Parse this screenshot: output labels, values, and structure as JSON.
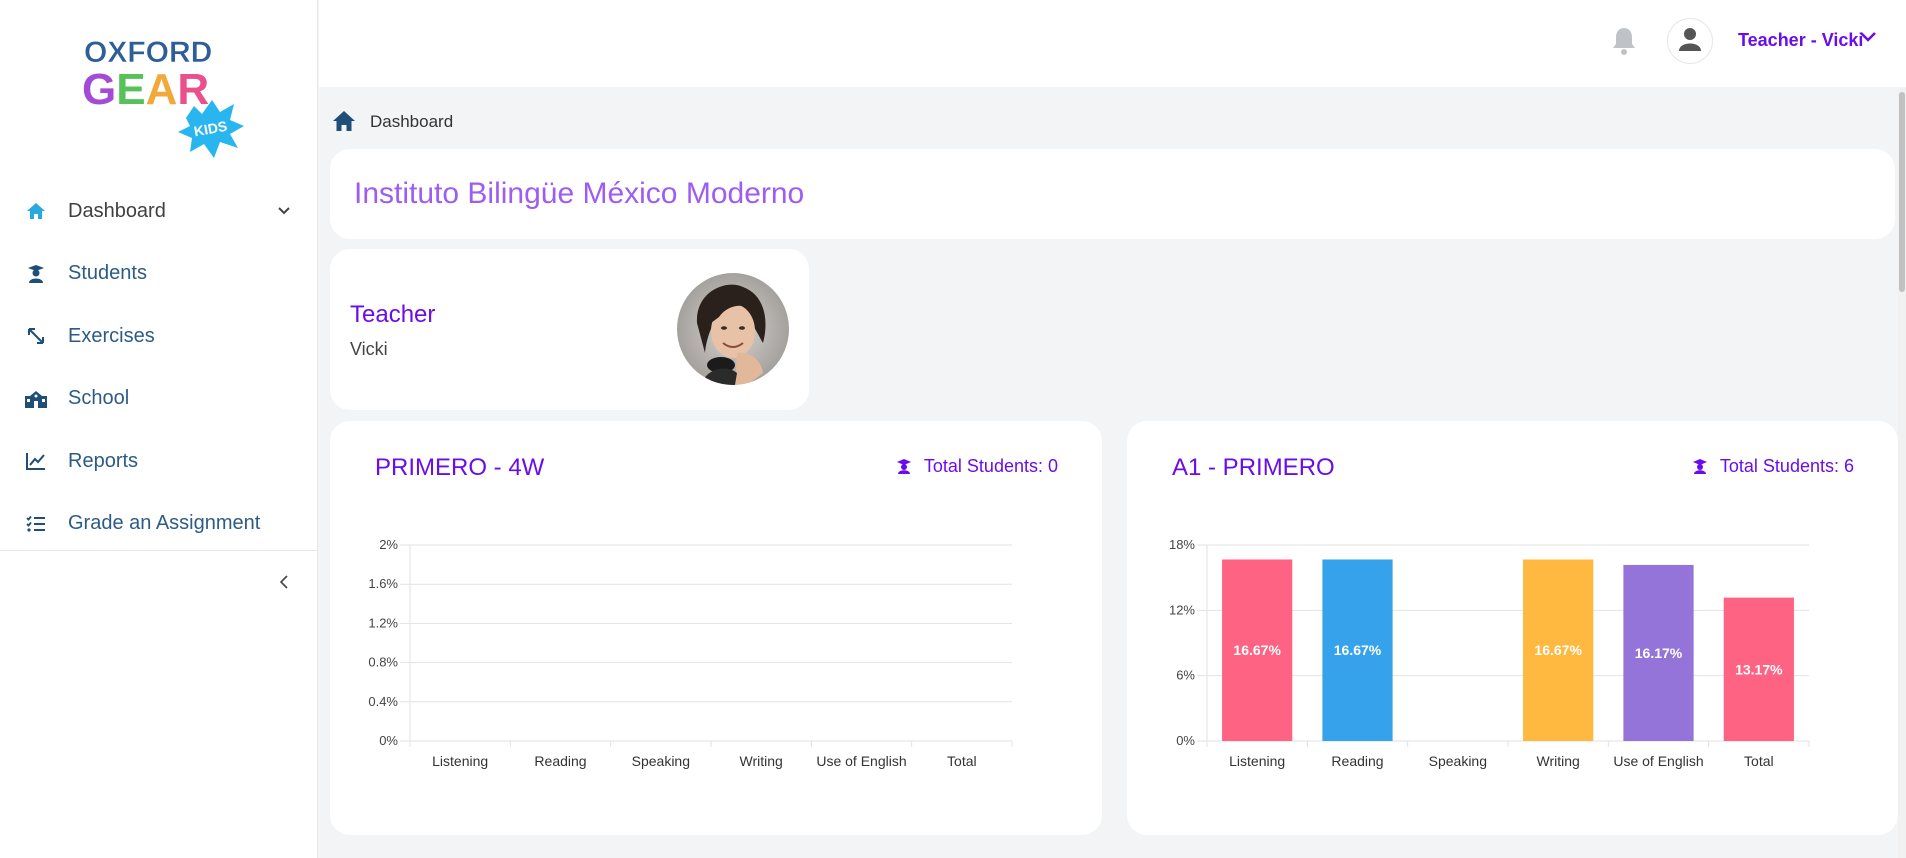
{
  "brand": {
    "line1": "OXFORD",
    "line2": "GEAR",
    "badge": "KIDS"
  },
  "sidebar": {
    "items": [
      {
        "label": "Dashboard",
        "icon": "home-icon"
      },
      {
        "label": "Students",
        "icon": "student-icon"
      },
      {
        "label": "Exercises",
        "icon": "arrows-icon"
      },
      {
        "label": "School",
        "icon": "school-icon"
      },
      {
        "label": "Reports",
        "icon": "chart-line-icon"
      },
      {
        "label": "Grade an Assignment",
        "icon": "list-check-icon"
      }
    ]
  },
  "topbar": {
    "user_label": "Teacher - Vicki"
  },
  "breadcrumb": {
    "current": "Dashboard"
  },
  "school": {
    "name": "Instituto Bilingüe México Moderno"
  },
  "teacher": {
    "role": "Teacher",
    "name": "Vicki"
  },
  "colors": {
    "accent": "#6a0dea",
    "school_title": "#9e5df2",
    "nav_text": "#2c5c86"
  },
  "groups": [
    {
      "title": "PRIMERO - 4W",
      "total_label": "Total Students: 0"
    },
    {
      "title": "A1 - PRIMERO",
      "total_label": "Total Students: 6"
    }
  ],
  "chart_data": [
    {
      "type": "bar",
      "categories": [
        "Listening",
        "Reading",
        "Speaking",
        "Writing",
        "Use of English",
        "Total"
      ],
      "values": [
        0,
        0,
        0,
        0,
        0,
        0
      ],
      "ylim": [
        0,
        2
      ],
      "yticks": [
        0,
        0.4,
        0.8,
        1.2,
        1.6,
        2
      ],
      "yticklabels": [
        "0%",
        "0.4%",
        "0.8%",
        "1.2%",
        "1.6%",
        "2%"
      ],
      "grid": true
    },
    {
      "type": "bar",
      "categories": [
        "Listening",
        "Reading",
        "Speaking",
        "Writing",
        "Use of English",
        "Total"
      ],
      "values": [
        16.67,
        16.67,
        0,
        16.67,
        16.17,
        13.17
      ],
      "data_labels": [
        "16.67%",
        "16.67%",
        "",
        "16.67%",
        "16.17%",
        "13.17%"
      ],
      "colors": [
        "#ff6384",
        "#36a2eb",
        "#4bc0c0",
        "#ffb940",
        "#9474d8",
        "#ff6384"
      ],
      "ylim": [
        0,
        18
      ],
      "yticks": [
        0,
        6,
        12,
        18
      ],
      "yticklabels": [
        "0%",
        "6%",
        "12%",
        "18%"
      ],
      "grid": true
    }
  ]
}
